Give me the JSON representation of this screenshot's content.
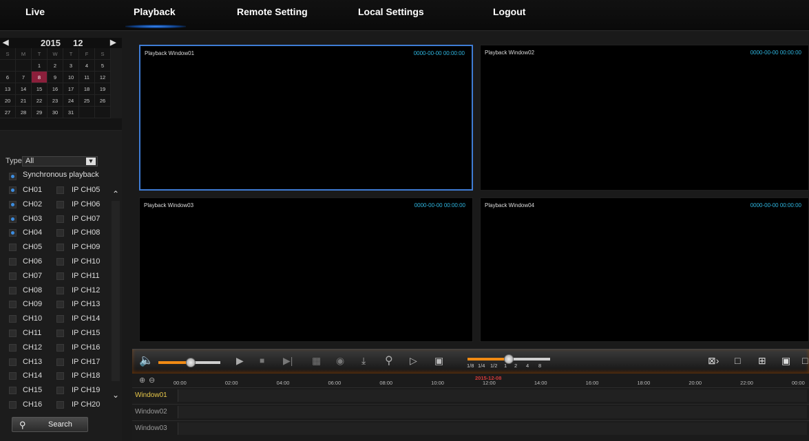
{
  "nav": {
    "live": "Live",
    "playback": "Playback",
    "remote": "Remote Setting",
    "local": "Local Settings",
    "logout": "Logout"
  },
  "calendar": {
    "year": "2015",
    "month": "12",
    "weekdays": [
      "S",
      "M",
      "T",
      "W",
      "T",
      "F",
      "S"
    ],
    "days": [
      [
        "",
        "",
        "1",
        "2",
        "3",
        "4",
        "5"
      ],
      [
        "6",
        "7",
        "8",
        "9",
        "10",
        "11",
        "12"
      ],
      [
        "13",
        "14",
        "15",
        "16",
        "17",
        "18",
        "19"
      ],
      [
        "20",
        "21",
        "22",
        "23",
        "24",
        "25",
        "26"
      ],
      [
        "27",
        "28",
        "29",
        "30",
        "31",
        "",
        ""
      ]
    ],
    "selected_day": "8"
  },
  "filters": {
    "type_label": "Type",
    "type_value": "All",
    "sync_label": "Synchronous playback"
  },
  "channels": [
    [
      "CH01",
      "IP CH05"
    ],
    [
      "CH02",
      "IP CH06"
    ],
    [
      "CH03",
      "IP CH07"
    ],
    [
      "CH04",
      "IP CH08"
    ],
    [
      "CH05",
      "IP CH09"
    ],
    [
      "CH06",
      "IP CH10"
    ],
    [
      "CH07",
      "IP CH11"
    ],
    [
      "CH08",
      "IP CH12"
    ],
    [
      "CH09",
      "IP CH13"
    ],
    [
      "CH10",
      "IP CH14"
    ],
    [
      "CH11",
      "IP CH15"
    ],
    [
      "CH12",
      "IP CH16"
    ],
    [
      "CH13",
      "IP CH17"
    ],
    [
      "CH14",
      "IP CH18"
    ],
    [
      "CH15",
      "IP CH19"
    ],
    [
      "CH16",
      "IP CH20"
    ]
  ],
  "checked_channels": [
    "CH01",
    "CH02",
    "CH03",
    "CH04"
  ],
  "search_label": "Search",
  "windows": [
    {
      "title": "Playback Window01",
      "time": "0000-00-00 00:00:00"
    },
    {
      "title": "Playback Window02",
      "time": "0000-00-00 00:00:00"
    },
    {
      "title": "Playback Window03",
      "time": "0000-00-00 00:00:00"
    },
    {
      "title": "Playback Window04",
      "time": "0000-00-00 00:00:00"
    }
  ],
  "speeds": [
    "1/8",
    "1/4",
    "1/2",
    "1",
    "2",
    "4",
    "8"
  ],
  "timeline": {
    "date": "2015-12-08",
    "hours": [
      "00:00",
      "02:00",
      "04:00",
      "06:00",
      "08:00",
      "10:00",
      "12:00",
      "14:00",
      "16:00",
      "18:00",
      "20:00",
      "22:00",
      "00:00"
    ],
    "rows": [
      "Window01",
      "Window02",
      "Window03"
    ]
  },
  "colors": {
    "accent": "#3f7dd6",
    "selected_day": "#8b1f3b",
    "orange": "#f08a14",
    "timestamp": "#2fb6e0"
  }
}
